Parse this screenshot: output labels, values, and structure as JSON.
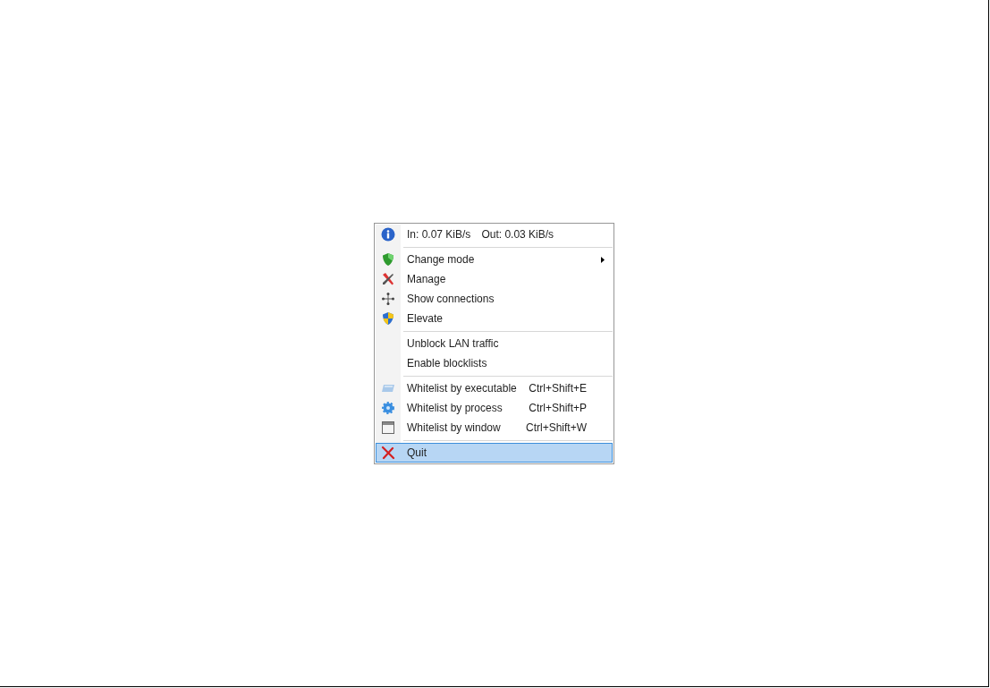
{
  "context_menu": {
    "items": [
      {
        "kind": "stats",
        "inbound": "In: 0.07 KiB/s",
        "outbound": "Out: 0.03 KiB/s"
      },
      {
        "kind": "separator"
      },
      {
        "kind": "item",
        "label": "Change mode",
        "submenu": true,
        "selected": false
      },
      {
        "kind": "item",
        "label": "Manage",
        "submenu": false,
        "selected": false
      },
      {
        "kind": "item",
        "label": "Show connections",
        "submenu": false,
        "selected": false
      },
      {
        "kind": "item",
        "label": "Elevate",
        "submenu": false,
        "selected": false
      },
      {
        "kind": "separator"
      },
      {
        "kind": "item",
        "label": "Unblock LAN traffic",
        "submenu": false,
        "selected": false
      },
      {
        "kind": "item",
        "label": "Enable blocklists",
        "submenu": false,
        "selected": false
      },
      {
        "kind": "separator"
      },
      {
        "kind": "item",
        "label": "Whitelist by executable",
        "shortcut": "Ctrl+Shift+E",
        "submenu": false,
        "selected": false
      },
      {
        "kind": "item",
        "label": "Whitelist by process",
        "shortcut": "Ctrl+Shift+P",
        "submenu": false,
        "selected": false
      },
      {
        "kind": "item",
        "label": "Whitelist by window",
        "shortcut": "Ctrl+Shift+W",
        "submenu": false,
        "selected": false
      },
      {
        "kind": "separator"
      },
      {
        "kind": "item",
        "label": "Quit",
        "submenu": false,
        "selected": true
      }
    ]
  }
}
